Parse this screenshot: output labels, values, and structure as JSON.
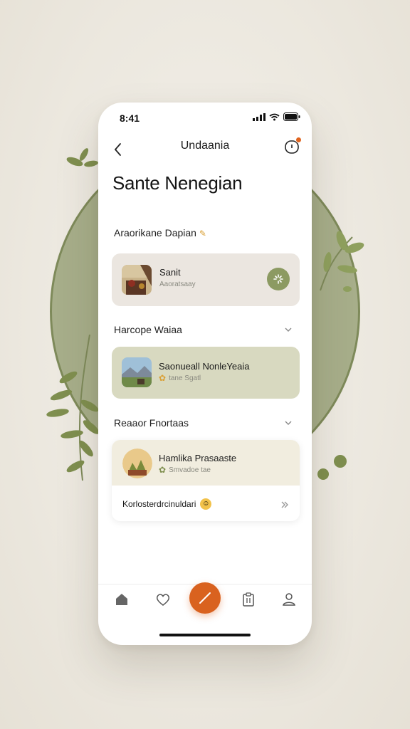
{
  "status_bar": {
    "time": "8:41"
  },
  "nav": {
    "title": "Undaania"
  },
  "page": {
    "title": "Sante Nenegian"
  },
  "sections": [
    {
      "heading": "Araorikane Dapian",
      "card": {
        "title": "Sanit",
        "subtitle": "Aaoratsaay"
      }
    },
    {
      "heading": "Harcope Waiaa",
      "card": {
        "title": "Saonueall NonleYeaia",
        "subtitle": "tane Sgatl"
      }
    },
    {
      "heading": "Reaaor Fnortaas",
      "card": {
        "title": "Hamlika Prasaaste",
        "subtitle": "Smvadoe tae"
      },
      "footer_text": "Korlosterdrcinuldari"
    }
  ],
  "tab_bar": {
    "items": [
      "home-icon",
      "heart-icon",
      "edit-icon",
      "clipboard-icon",
      "profile-icon"
    ]
  },
  "colors": {
    "accent": "#d9621f",
    "sage": "#8c9a62",
    "background": "#ece8df"
  }
}
